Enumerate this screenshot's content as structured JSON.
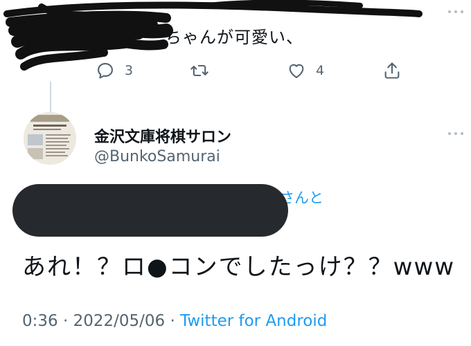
{
  "top_tweet": {
    "text": "ちゃんが可愛い、",
    "actions": {
      "reply_count": "3",
      "retweet_count": "",
      "like_count": "4"
    }
  },
  "main_tweet": {
    "display_name": "金沢文庫将棋サロン",
    "handle": "@BunkoSamurai",
    "replying_suffix": "さんと",
    "text": "あれ！？ロ●コンでしたっけ？？www",
    "time": "0:36",
    "date": "2022/05/06",
    "separator": "·",
    "source": "Twitter for Android"
  },
  "colors": {
    "accent": "#1d9bf0",
    "secondary_text": "#536471",
    "primary_text": "#0f1419",
    "redaction": "#26292d"
  }
}
